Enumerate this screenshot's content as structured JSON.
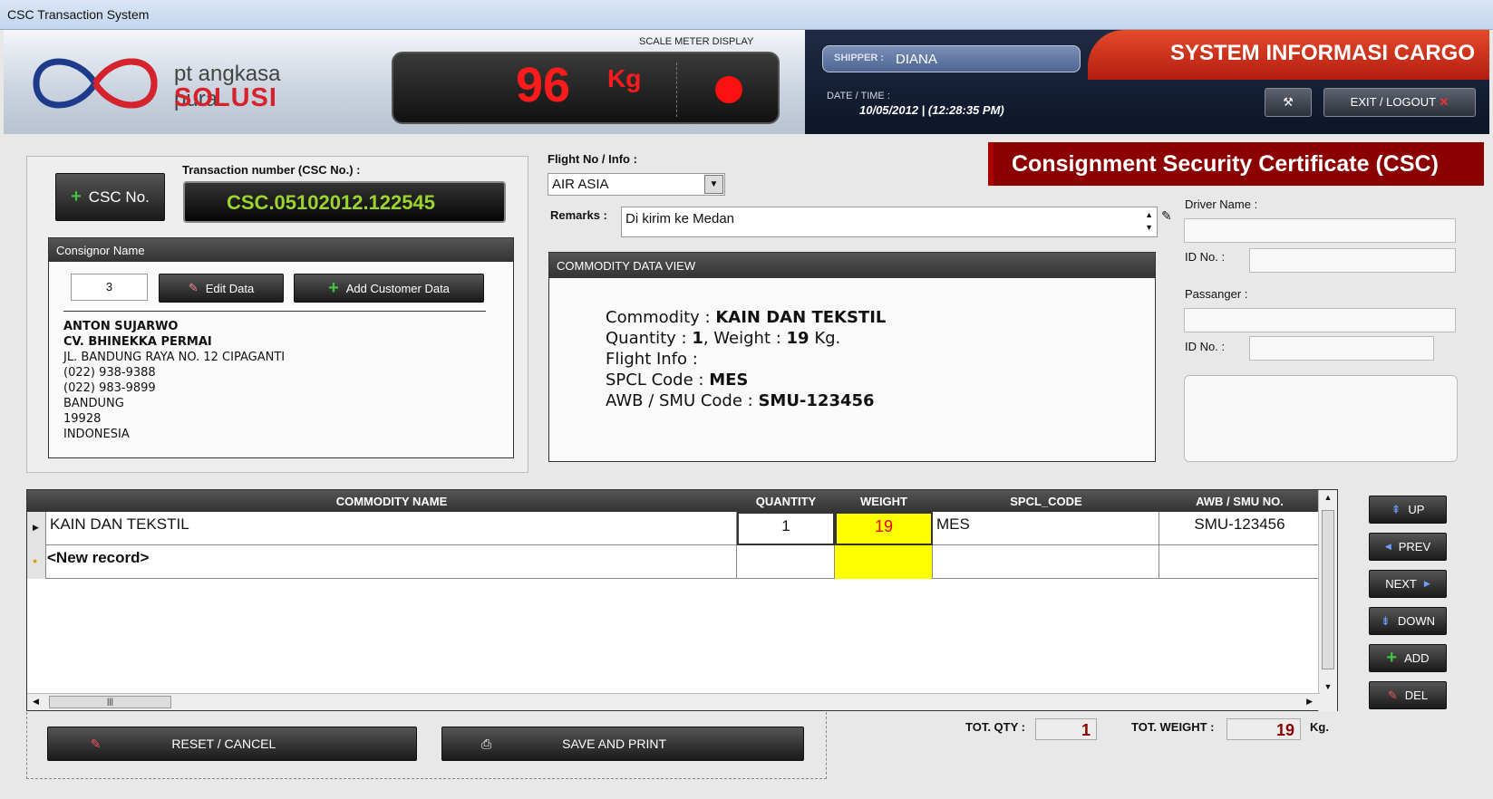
{
  "window": {
    "title": "CSC Transaction System"
  },
  "logo": {
    "line1": "pt angkasa pura",
    "line2": "SOLUSI"
  },
  "scale": {
    "label": "SCALE METER DISPLAY",
    "value": "96",
    "unit": "Kg"
  },
  "shipper": {
    "label": "SHIPPER :",
    "value": "DIANA"
  },
  "datetime": {
    "label": "DATE / TIME :",
    "value": "10/05/2012 | (12:28:35 PM)"
  },
  "system_title": "SYSTEM INFORMASI CARGO",
  "header_buttons": {
    "exit_label": "EXIT / LOGOUT"
  },
  "csc_banner": "Consignment Security Certificate (CSC)",
  "transaction": {
    "button_label": "CSC No.",
    "label": "Transaction number (CSC No.) :",
    "value": "CSC.05102012.122545"
  },
  "consignor": {
    "header": "Consignor Name",
    "id": "3",
    "edit_label": "Edit Data",
    "add_label": "Add Customer Data",
    "name": "ANTON SUJARWO",
    "company": "CV. BHINEKKA PERMAI",
    "lines": [
      "JL. BANDUNG RAYA NO. 12 CIPAGANTI",
      "(022) 938-9388",
      "(022) 983-9899",
      "BANDUNG",
      "19928",
      "INDONESIA"
    ]
  },
  "flight": {
    "label": "Flight No / Info :",
    "value": "AIR ASIA"
  },
  "remarks": {
    "label": "Remarks :",
    "value": "Di kirim ke Medan"
  },
  "commodity_view": {
    "header": "COMMODITY DATA VIEW",
    "commodity_label": "Commodity :",
    "commodity": "KAIN DAN TEKSTIL",
    "quantity_label": "Quantity :",
    "quantity": "1",
    "weight_label": ", Weight :",
    "weight": "19",
    "weight_unit": "Kg.",
    "flight_label": "Flight Info :",
    "spcl_label": "SPCL Code :",
    "spcl": "MES",
    "awb_label": "AWB / SMU Code :",
    "awb": "SMU-123456"
  },
  "driver": {
    "label": "Driver Name :",
    "id_label": "ID No. :"
  },
  "passenger": {
    "label": "Passanger :",
    "id_label": "ID No. :"
  },
  "grid": {
    "columns": [
      "COMMODITY NAME",
      "QUANTITY",
      "WEIGHT",
      "SPCL_CODE",
      "AWB / SMU NO."
    ],
    "rows": [
      {
        "name": "KAIN DAN TEKSTIL",
        "qty": "1",
        "weight": "19",
        "spcl": "MES",
        "awb": "SMU-123456"
      }
    ],
    "new_record": "<New record>"
  },
  "nav": {
    "up": "UP",
    "prev": "PREV",
    "next": "NEXT",
    "down": "DOWN",
    "add": "ADD",
    "del": "DEL"
  },
  "footer": {
    "reset_label": "RESET / CANCEL",
    "save_label": "SAVE AND  PRINT",
    "tot_qty_label": "TOT. QTY :",
    "tot_qty": "1",
    "tot_weight_label": "TOT. WEIGHT :",
    "tot_weight": "19",
    "kg_label": "Kg."
  },
  "colors": {
    "accent_red": "#8b0000",
    "digit_green": "#9bd42e",
    "scale_red": "#ff1b1b",
    "weight_cell": "#ffff00"
  }
}
